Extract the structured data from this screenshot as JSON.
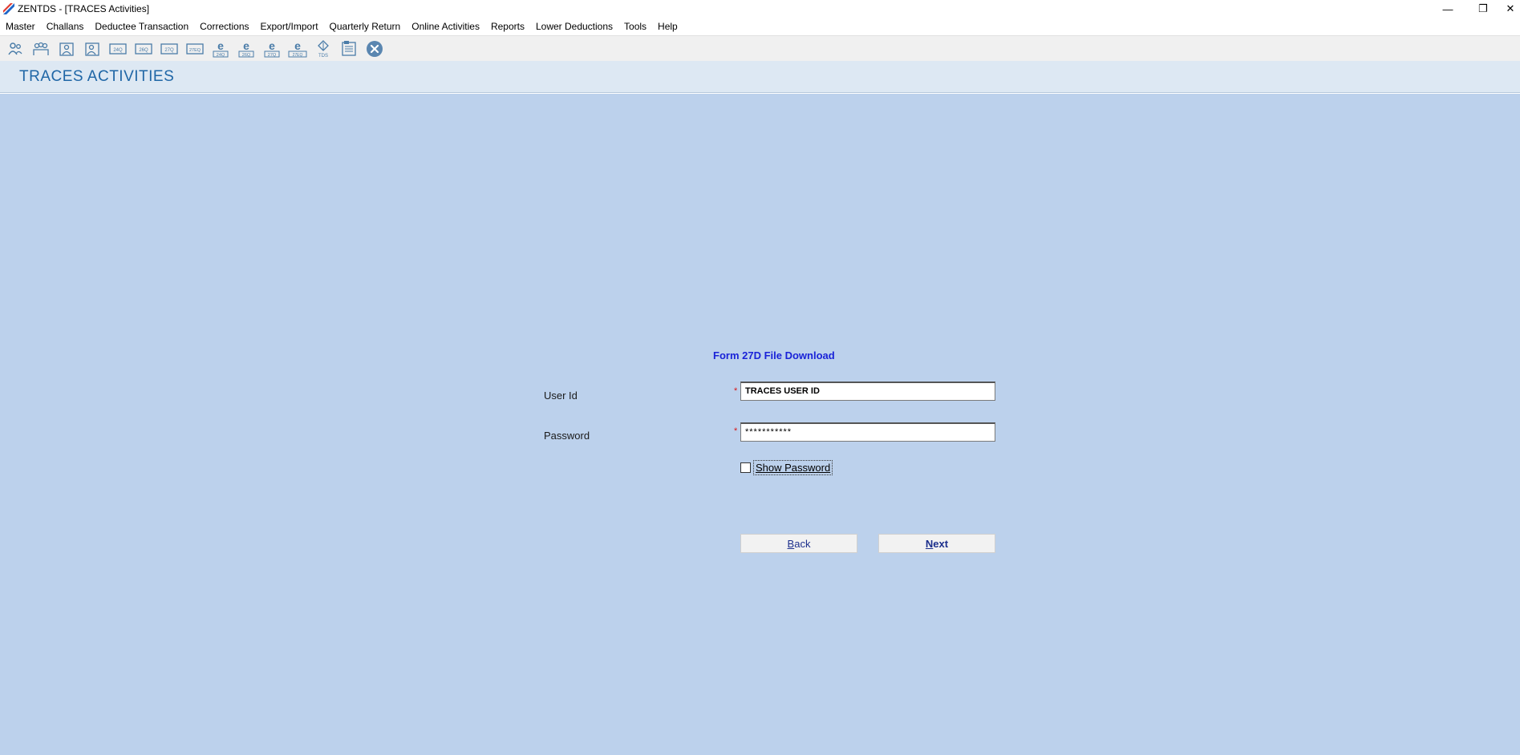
{
  "window": {
    "title": "ZENTDS - [TRACES Activities]",
    "minimize_glyph": "—",
    "maximize_glyph": "❐",
    "close_glyph": "✕"
  },
  "menu": [
    "Master",
    "Challans",
    "Deductee Transaction",
    "Corrections",
    "Export/Import",
    "Quarterly Return",
    "Online Activities",
    "Reports",
    "Lower Deductions",
    "Tools",
    "Help"
  ],
  "toolbar": {
    "icons": [
      "deductor-icon",
      "deductees-icon",
      "employee-icon",
      "employee-alt-icon",
      "form-24q-icon",
      "form-26q-icon",
      "form-27q-icon",
      "form-27eq-icon",
      "e-24q-icon",
      "e-26q-icon",
      "e-27q-icon",
      "e-27eq-icon",
      "tds-icon",
      "report-icon",
      "close-circle-icon"
    ],
    "small_labels": [
      "",
      "",
      "",
      "",
      "24Q",
      "26Q",
      "27Q",
      "27EQ",
      "24Q",
      "26Q",
      "27Q",
      "27EQ",
      "TDS",
      "",
      ""
    ]
  },
  "header": {
    "title": "TRACES ACTIVITIES"
  },
  "form": {
    "title": "Form 27D File Download",
    "user_id_label": "User Id",
    "password_label": "Password",
    "required_mark": "*",
    "user_id_value": "TRACES USER ID",
    "password_value": "***********",
    "show_password_label": "Show Password",
    "show_password_checked": false,
    "back_label_mnemonic": "B",
    "back_label_rest": "ack",
    "next_label_mnemonic": "N",
    "next_label_rest": "ext"
  },
  "colors": {
    "main_bg": "#bcd1ec",
    "header_bg": "#dde8f3",
    "header_text": "#1f66a6",
    "form_title": "#1a23d8",
    "required": "#d81818"
  }
}
